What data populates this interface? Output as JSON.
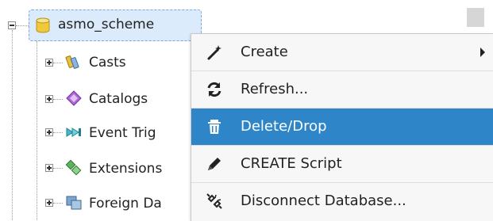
{
  "tree": {
    "root": {
      "label": "asmo_scheme",
      "icon": "database-icon"
    },
    "children": [
      {
        "label": "Casts",
        "icon": "casts-icon"
      },
      {
        "label": "Catalogs",
        "icon": "catalogs-icon"
      },
      {
        "label": "Event Trig",
        "icon": "event-triggers-icon"
      },
      {
        "label": "Extensions",
        "icon": "extensions-icon"
      },
      {
        "label": "Foreign Da",
        "icon": "foreign-data-icon"
      }
    ]
  },
  "context_menu": {
    "items": [
      {
        "label": "Create",
        "icon": "wand-icon",
        "has_submenu": true
      },
      {
        "label": "Refresh...",
        "icon": "refresh-icon"
      },
      {
        "label": "Delete/Drop",
        "icon": "trash-icon",
        "highlighted": true
      },
      {
        "label": "CREATE Script",
        "icon": "pencil-icon"
      },
      {
        "label": "Disconnect Database...",
        "icon": "disconnect-icon"
      }
    ]
  },
  "colors": {
    "selection_bg": "#dcebfb",
    "menu_highlight": "#2e86c9",
    "menu_bg": "#f7f7f7"
  }
}
